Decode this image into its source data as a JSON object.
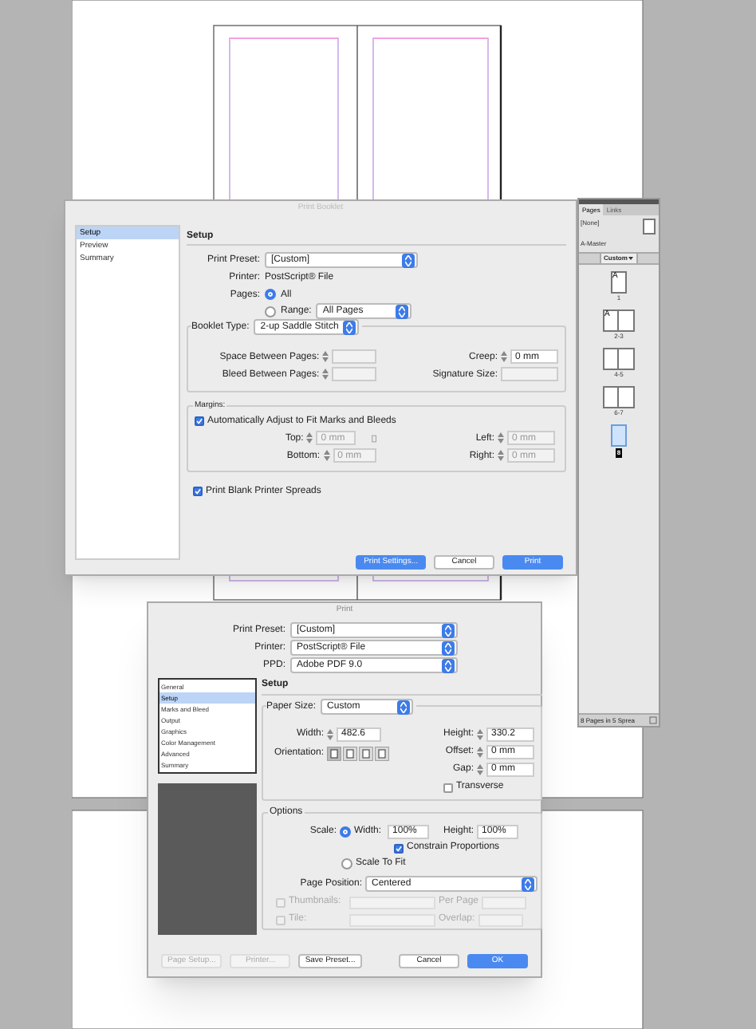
{
  "print_booklet": {
    "title": "Print Booklet",
    "sidebar": [
      {
        "label": "Setup",
        "selected": true
      },
      {
        "label": "Preview",
        "selected": false
      },
      {
        "label": "Summary",
        "selected": false
      }
    ],
    "section_title": "Setup",
    "print_preset": {
      "label": "Print Preset:",
      "value": "[Custom]"
    },
    "printer": {
      "label": "Printer:",
      "value": "PostScript® File"
    },
    "pages": {
      "label": "Pages:",
      "options": [
        {
          "label": "All",
          "selected": true
        },
        {
          "label": "Range:",
          "selected": false
        }
      ],
      "range_value": "All Pages"
    },
    "booklet_type": {
      "label": "Booklet Type:",
      "value": "2-up Saddle Stitch"
    },
    "booklet_fields": [
      {
        "label": "Space Between Pages:",
        "kind": "stepper"
      },
      {
        "label": "Creep:",
        "kind": "stepper",
        "value": "0 mm"
      },
      {
        "label": "Bleed Between Pages:",
        "kind": "stepper"
      },
      {
        "label": "Signature Size:",
        "kind": "popup"
      }
    ],
    "margins": {
      "legend": "Margins:",
      "auto_adjust": {
        "label": "Automatically Adjust to Fit Marks and Bleeds",
        "checked": true
      },
      "fields": [
        {
          "label": "Top:",
          "value": "0 mm"
        },
        {
          "label": "Left:",
          "value": "0 mm"
        },
        {
          "label": "Bottom:",
          "value": "0 mm"
        },
        {
          "label": "Right:",
          "value": "0 mm"
        }
      ]
    },
    "print_blank": {
      "label": "Print Blank Printer Spreads",
      "checked": true
    },
    "buttons": [
      {
        "label": "Print Settings...",
        "kind": "primary"
      },
      {
        "label": "Cancel",
        "kind": "normal"
      },
      {
        "label": "Print",
        "kind": "primary"
      }
    ]
  },
  "pages_panel": {
    "tabs": [
      {
        "label": "Pages",
        "selected": true
      },
      {
        "label": "Links",
        "selected": false
      }
    ],
    "masters": [
      "[None]",
      "A-Master"
    ],
    "view": "Custom",
    "spreads": [
      {
        "kind": "single",
        "label": "1",
        "master": "A",
        "selected": false
      },
      {
        "kind": "spread",
        "label": "2-3",
        "master": "A",
        "selected": false
      },
      {
        "kind": "spread",
        "label": "4-5",
        "selected": false
      },
      {
        "kind": "spread",
        "label": "6-7",
        "selected": false
      },
      {
        "kind": "single",
        "label": "8",
        "selected": true
      }
    ],
    "status": "8 Pages in 5 Sprea"
  },
  "print": {
    "title": "Print",
    "top_fields": [
      {
        "label": "Print Preset:",
        "value": "[Custom]"
      },
      {
        "label": "Printer:",
        "value": "PostScript® File"
      },
      {
        "label": "PPD:",
        "value": "Adobe PDF 9.0"
      }
    ],
    "sidebar": [
      {
        "label": "General",
        "selected": false
      },
      {
        "label": "Setup",
        "selected": true
      },
      {
        "label": "Marks and Bleed",
        "selected": false
      },
      {
        "label": "Output",
        "selected": false
      },
      {
        "label": "Graphics",
        "selected": false
      },
      {
        "label": "Color Management",
        "selected": false
      },
      {
        "label": "Advanced",
        "selected": false
      },
      {
        "label": "Summary",
        "selected": false
      }
    ],
    "section_title": "Setup",
    "paper_size": {
      "label": "Paper Size:",
      "value": "Custom"
    },
    "width": {
      "label": "Width:",
      "value": "482.6"
    },
    "height": {
      "label": "Height:",
      "value": "330.2"
    },
    "orientation": {
      "label": "Orientation:",
      "options": [
        {
          "selected": true
        },
        {
          "selected": false
        },
        {
          "selected": false
        },
        {
          "selected": false
        }
      ]
    },
    "offset": {
      "label": "Offset:",
      "value": "0 mm"
    },
    "gap": {
      "label": "Gap:",
      "value": "0 mm"
    },
    "transverse": {
      "label": "Transverse",
      "checked": false
    },
    "options": {
      "legend": "Options",
      "scale_label": "Scale:",
      "width": {
        "label": "Width:",
        "value": "100%",
        "selected": true
      },
      "height": {
        "label": "Height:",
        "value": "100%"
      },
      "constrain": {
        "label": "Constrain Proportions",
        "checked": true
      },
      "scale_to_fit": {
        "label": "Scale To Fit",
        "selected": false
      },
      "page_position": {
        "label": "Page Position:",
        "value": "Centered"
      },
      "thumbnails": {
        "label": "Thumbnails:",
        "checked": false,
        "disabled": true,
        "suffix": "Per Page"
      },
      "tile": {
        "label": "Tile:",
        "checked": false,
        "disabled": true,
        "suffix": "Overlap:"
      }
    },
    "buttons": [
      {
        "label": "Page Setup...",
        "kind": "normal",
        "disabled": true
      },
      {
        "label": "Printer...",
        "kind": "normal",
        "disabled": true
      },
      {
        "label": "Save Preset...",
        "kind": "normal",
        "disabled": false
      },
      {
        "label": "Cancel",
        "kind": "normal",
        "disabled": false
      },
      {
        "label": "OK",
        "kind": "primary",
        "disabled": false
      }
    ]
  }
}
